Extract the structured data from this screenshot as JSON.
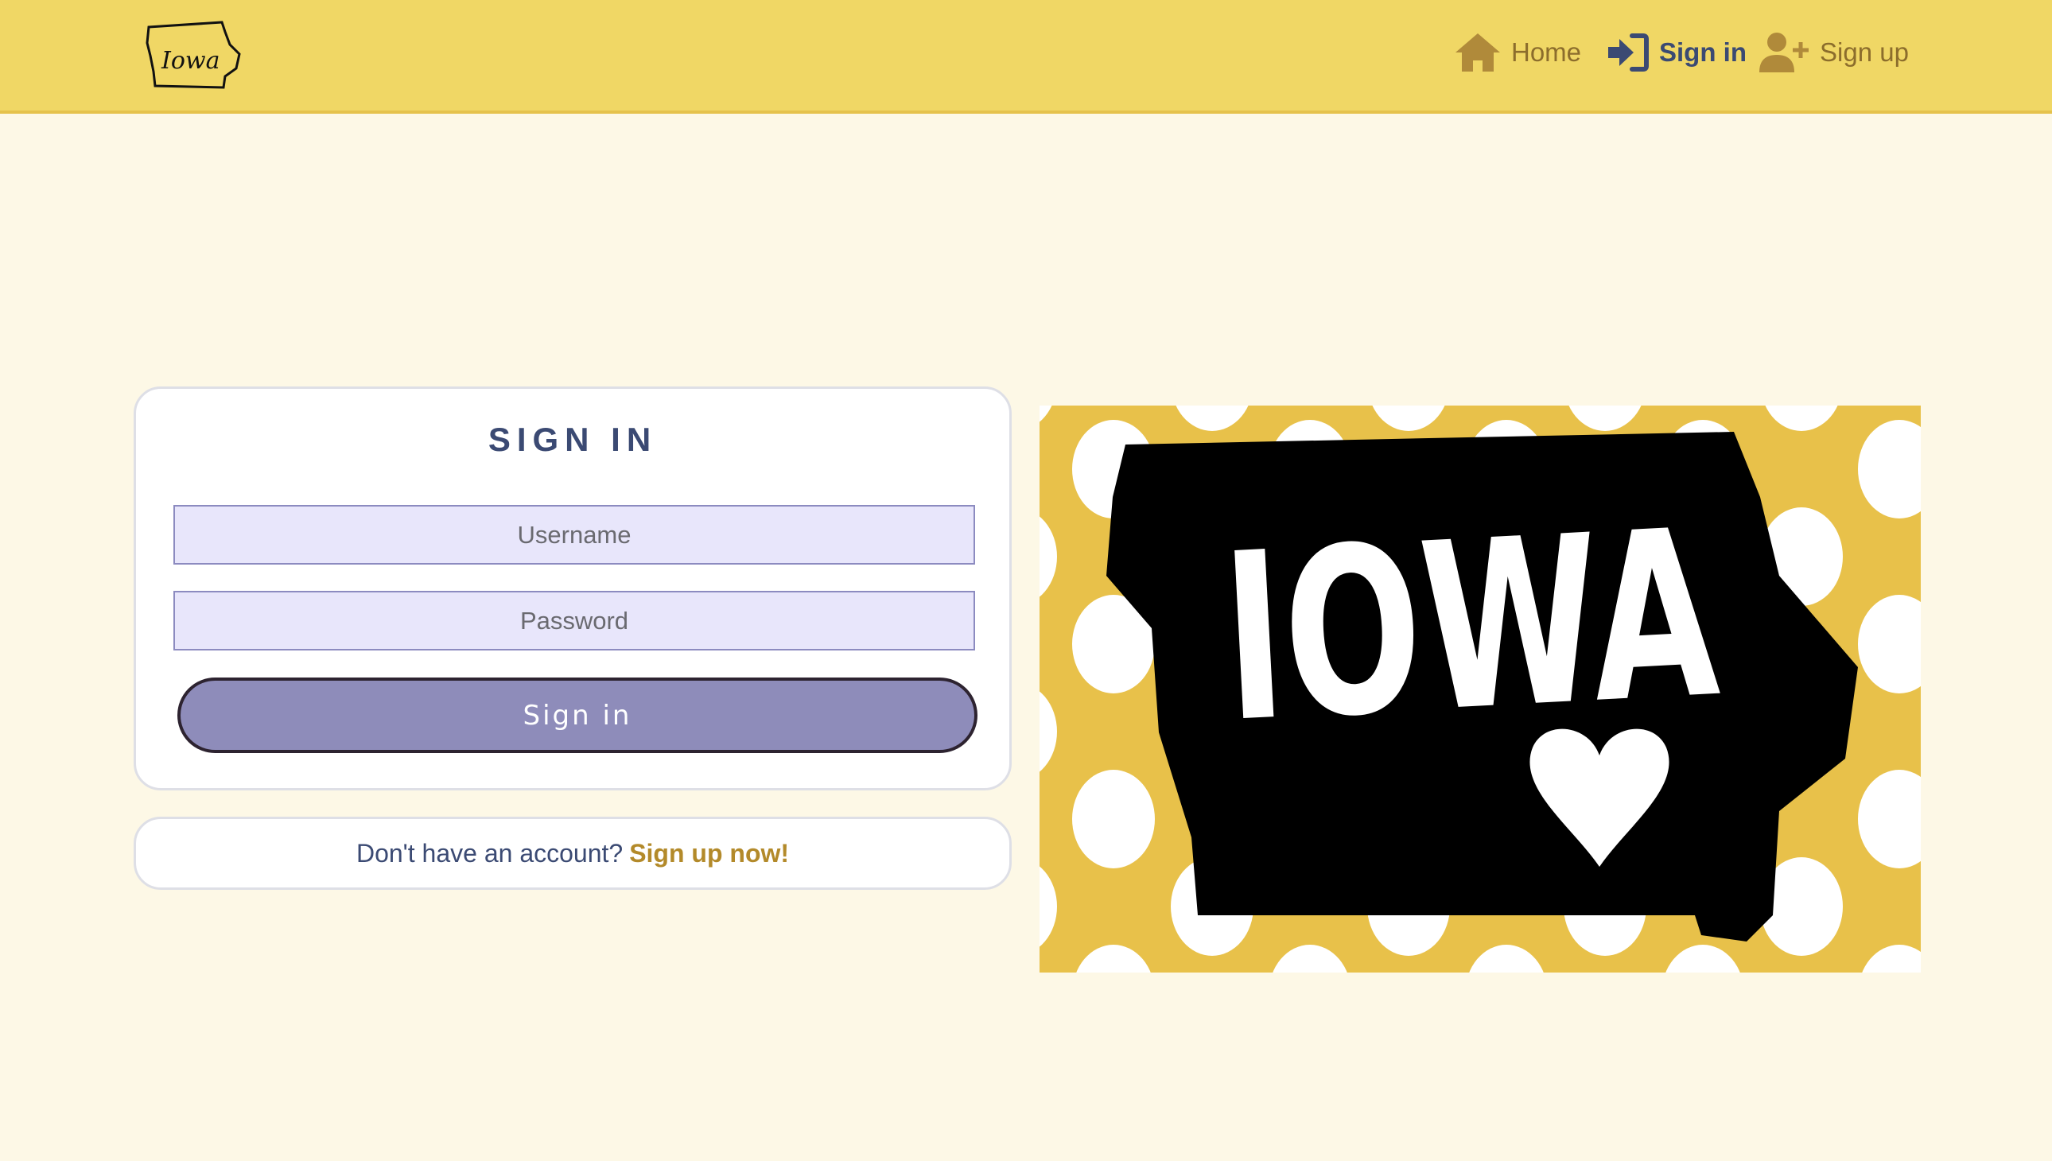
{
  "header": {
    "logo_text": "Iowa",
    "nav": [
      {
        "label": "Home",
        "icon": "home-icon"
      },
      {
        "label": "Sign in",
        "icon": "sign-in-icon",
        "active": true
      },
      {
        "label": "Sign up",
        "icon": "user-plus-icon"
      }
    ]
  },
  "signin": {
    "title": "SIGN IN",
    "username_placeholder": "Username",
    "password_placeholder": "Password",
    "submit_label": "Sign in"
  },
  "signup_prompt": {
    "text": "Don't have an account?",
    "link": "Sign up now!"
  },
  "hero": {
    "text": "IOWA"
  },
  "colors": {
    "header": "#f0d765",
    "accent": "#b38a2a",
    "primary": "#3b4a73",
    "button": "#8e8cba",
    "background": "#fdf8e6"
  }
}
